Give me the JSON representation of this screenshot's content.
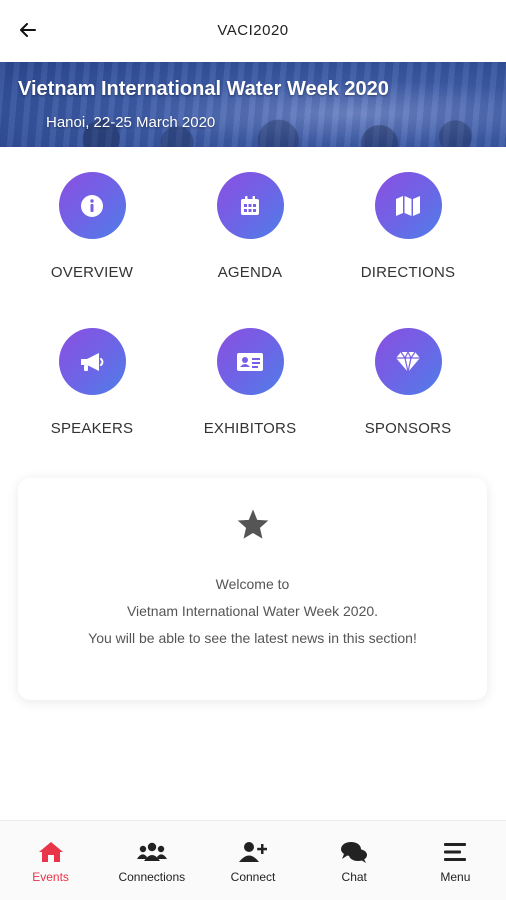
{
  "topbar": {
    "title": "VACI2020",
    "back_icon": "arrow-left-icon"
  },
  "banner": {
    "title": "Vietnam International Water Week 2020",
    "subtitle": "Hanoi, 22-25 March 2020"
  },
  "tiles": [
    {
      "label": "OVERVIEW",
      "icon": "info-icon"
    },
    {
      "label": "AGENDA",
      "icon": "calendar-icon"
    },
    {
      "label": "DIRECTIONS",
      "icon": "map-icon"
    },
    {
      "label": "SPEAKERS",
      "icon": "megaphone-icon"
    },
    {
      "label": "EXHIBITORS",
      "icon": "id-card-icon"
    },
    {
      "label": "SPONSORS",
      "icon": "diamond-icon"
    }
  ],
  "welcome": {
    "icon": "star-icon",
    "line1": "Welcome to",
    "line2": "Vietnam International Water Week 2020.",
    "line3": "You will be able to see the latest news in this section!"
  },
  "nav": [
    {
      "label": "Events",
      "icon": "home-icon",
      "active": true
    },
    {
      "label": "Connections",
      "icon": "users-icon",
      "active": false
    },
    {
      "label": "Connect",
      "icon": "user-plus-icon",
      "active": false
    },
    {
      "label": "Chat",
      "icon": "chat-icon",
      "active": false
    },
    {
      "label": "Menu",
      "icon": "menu-icon",
      "active": false
    }
  ],
  "colors": {
    "accent_active": "#e8354a",
    "tile_gradient_start": "#8b4fe0",
    "tile_gradient_end": "#4f7ee8",
    "banner": "#3c5aa6"
  }
}
